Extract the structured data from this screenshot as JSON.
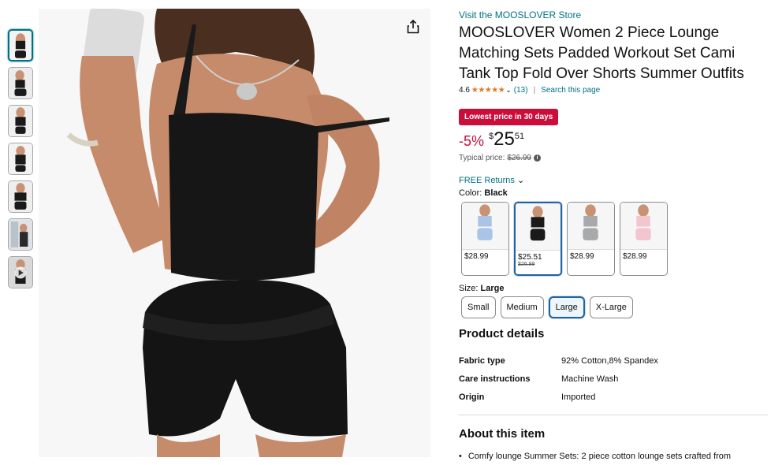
{
  "store": {
    "link_text": "Visit the MOOSLOVER Store"
  },
  "product": {
    "title": "MOOSLOVER Women 2 Piece Lounge Matching Sets Padded Workout Set Cami Tank Top Fold Over Shorts Summer Outfits"
  },
  "rating": {
    "value": "4.6",
    "stars": "★★★★★",
    "count": "(13)",
    "search_link": "Search this page",
    "star_color": "#de7921"
  },
  "deal": {
    "badge": "Lowest price in 30 days",
    "badge_color": "#cc0c39"
  },
  "price": {
    "discount": "-5%",
    "currency": "$",
    "whole": "25",
    "fraction": "51",
    "typical_label": "Typical price:",
    "typical_value": "$26.99",
    "info_icon": "info-icon"
  },
  "returns": {
    "label": "FREE Returns"
  },
  "color": {
    "label": "Color:",
    "selected": "Black",
    "options": [
      {
        "name": "Light Blue",
        "price": "$28.99",
        "old_price": "",
        "fill": "#a9c4e6"
      },
      {
        "name": "Black",
        "price": "$25.51",
        "old_price": "$26.99",
        "fill": "#1a1a1a"
      },
      {
        "name": "Grey",
        "price": "$28.99",
        "old_price": "",
        "fill": "#a7a9ab"
      },
      {
        "name": "Pink",
        "price": "$28.99",
        "old_price": "",
        "fill": "#f2c5cf"
      }
    ]
  },
  "size": {
    "label": "Size:",
    "selected": "Large",
    "options": [
      "Small",
      "Medium",
      "Large",
      "X-Large"
    ]
  },
  "details": {
    "title": "Product details",
    "rows": [
      {
        "key": "Fabric type",
        "value": "92% Cotton,8% Spandex"
      },
      {
        "key": "Care instructions",
        "value": "Machine Wash"
      },
      {
        "key": "Origin",
        "value": "Imported"
      }
    ]
  },
  "about": {
    "title": "About this item",
    "bullets": [
      "Comfy lounge Summer Sets: 2 piece cotton lounge sets crafted from"
    ]
  },
  "icons": {
    "share": "share-icon",
    "chevron": "chevron-down-icon",
    "play": "play-icon"
  },
  "accent_color": "#007185"
}
